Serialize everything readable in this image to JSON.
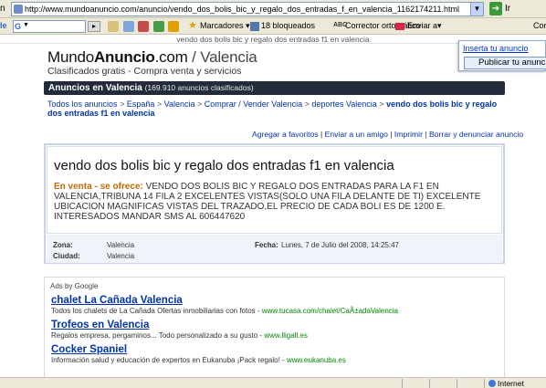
{
  "browser": {
    "address_label": "n",
    "url": "http://www.mundoanuncio.com/anuncio/vendo_dos_bolis_bic_y_regalo_dos_entradas_f_en_valencia_1162174211.html",
    "go_label": "Ir",
    "toolbar": {
      "google_letter": "le",
      "search_letter": "G",
      "bookmarks": "Marcadores",
      "blocked": "18 bloqueados",
      "spellcheck": "Corrector ortográfico",
      "send": "Enviar a",
      "con": "Con"
    },
    "page_title": "vendo dos bolis bic y regalo dos entradas f1 en valencia",
    "status_zone": "Internet"
  },
  "popup": {
    "link": "Inserta tu anuncio",
    "button": "Publicar tu anuncio"
  },
  "site": {
    "logo_prefix": "Mundo",
    "logo_bold": "Anuncio",
    "logo_suffix": ".com",
    "logo_city": " / Valencia",
    "tagline": "Clasificados gratis - Compra venta y servicios",
    "bar_title": "Anuncios en Valencia",
    "bar_count": "(169.910 anuncios clasificados)"
  },
  "breadcrumb": {
    "items": [
      "Todos los anuncios",
      "España",
      "Valencia",
      "Comprar / Vender Valencia",
      "deportes Valencia"
    ],
    "current": "vendo dos bolis bic y regalo dos entradas f1 en valencia"
  },
  "actions": [
    "Agregar a favoritos",
    "Enviar a un amigo",
    "Imprimir",
    "Borrar y denunciar anuncio"
  ],
  "ad": {
    "title": "vendo dos bolis bic y regalo dos entradas f1 en valencia",
    "label": "En venta - se ofrece:",
    "body": "VENDO DOS BOLIS BIC Y REGALO DOS ENTRADAS PARA LA F1 EN VALENCIA,TRIBUNA 14 FILA 2 EXCELENTES VISTAS(SOLO UNA FILA DELANTE DE TI) EXCELENTE UBICACION MAGNIFICAS VISTAS DEL TRAZADO,EL PRECIO DE CADA BOLI ES DE 1200 E. INTERESADOS MANDAR SMS AL 606447620",
    "zona_label": "Zona:",
    "zona": "Valencia",
    "ciudad_label": "Ciudad:",
    "ciudad": "Valencia",
    "fecha_label": "Fecha:",
    "fecha": "Lunes, 7 de Julio del 2008, 14:25:47"
  },
  "sponsored": {
    "header": "Ads by Google",
    "items": [
      {
        "title": "chalet La Cañada Valencia",
        "desc": "Todos los chalets de La Cañada Ofertas inmobiliarias con fotos - ",
        "url": "www.tucasa.com/chalet/CaÃ±adaValencia"
      },
      {
        "title": "Trofeos en Valencia",
        "desc": "Regalos empresa, pergaminos... Todo personalizado a su gusto - ",
        "url": "www.lligall.es"
      },
      {
        "title": "Cocker Spaniel",
        "desc": "Información salud y educación de expertos en Eukanuba ¡Pack regalo! - ",
        "url": "www.eukanuba.es"
      }
    ]
  }
}
